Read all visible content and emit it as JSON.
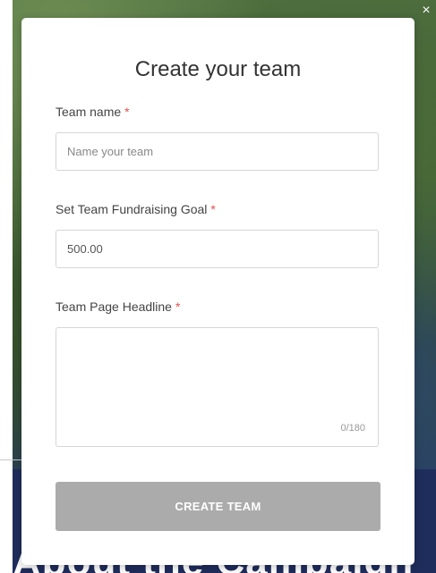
{
  "background": {
    "heading_text": "About the Campaign",
    "close_glyph": "×",
    "colors": {
      "photo": "#3b5a30",
      "band": "#1f2d5c"
    }
  },
  "modal": {
    "title": "Create your team",
    "required_marker": "*",
    "fields": {
      "team_name": {
        "label": "Team name",
        "placeholder": "Name your team",
        "value": ""
      },
      "goal": {
        "label": "Set Team Fundraising Goal",
        "value": "500.00"
      },
      "headline": {
        "label": "Team Page Headline",
        "value": "",
        "counter": "0/180"
      }
    },
    "submit_label": "CREATE TEAM",
    "colors": {
      "required": "#e0514b",
      "button_disabled": "#ababab"
    }
  }
}
